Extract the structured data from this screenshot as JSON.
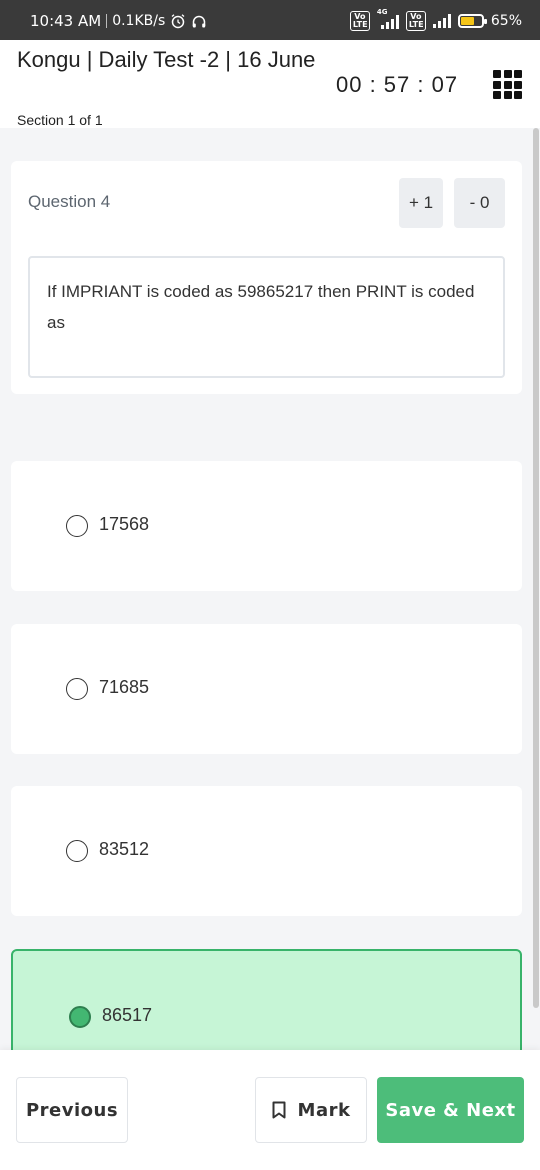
{
  "status_bar": {
    "time": "10:43 AM",
    "speed": "0.1KB/s",
    "network_label": "4G",
    "volte1": "Vo LTE",
    "volte2": "Vo LTE",
    "battery": "65%",
    "battery_level": 0.65,
    "icons": [
      "alarm-icon",
      "headphones-icon",
      "signal-icon",
      "battery-icon"
    ]
  },
  "header": {
    "title": "Kongu | Daily Test -2 | 16 June",
    "section": "Section 1 of 1",
    "timer": "00 : 57 : 07"
  },
  "question": {
    "label": "Question 4",
    "positive_marks": "+ 1",
    "negative_marks": "- 0",
    "text": "If IMPRIANT is coded as 59865217 then PRINT is coded as"
  },
  "options": [
    {
      "text": "17568",
      "selected": false
    },
    {
      "text": "71685",
      "selected": false
    },
    {
      "text": "83512",
      "selected": false
    },
    {
      "text": "86517",
      "selected": true
    }
  ],
  "footer": {
    "previous_label": "Previous",
    "mark_label": "Mark",
    "next_label": "Save & Next"
  },
  "colors": {
    "accent": "#4dbd7a",
    "selected_bg": "#c6f5d6",
    "status_bar": "#3a3a3a"
  }
}
